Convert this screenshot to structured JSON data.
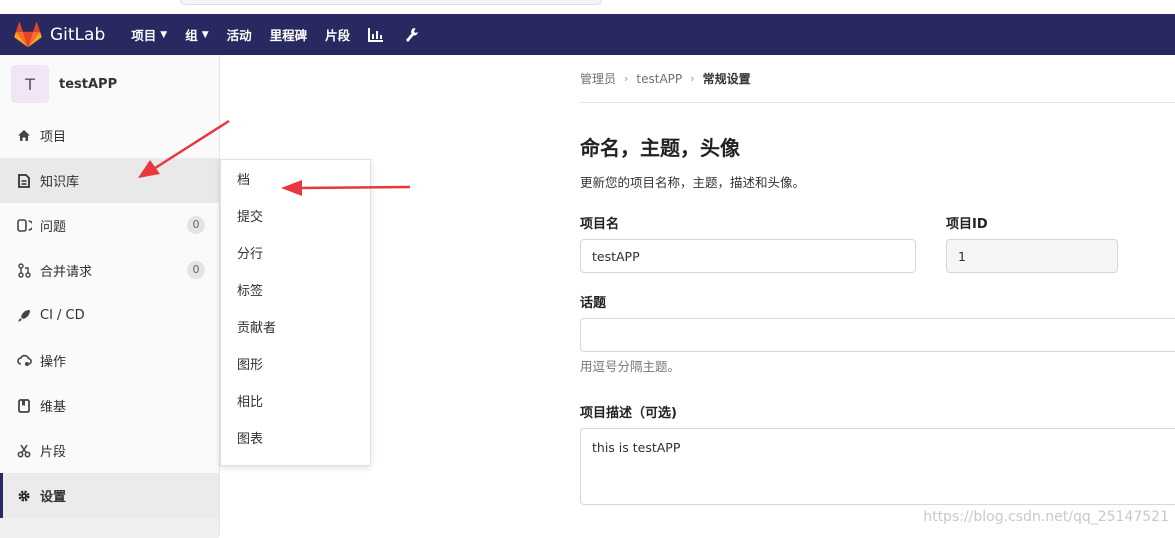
{
  "navbar": {
    "brand": "GitLab",
    "items": [
      {
        "label": "项目",
        "has_dropdown": true
      },
      {
        "label": "组",
        "has_dropdown": true
      },
      {
        "label": "活动",
        "has_dropdown": false
      },
      {
        "label": "里程碑",
        "has_dropdown": false
      },
      {
        "label": "片段",
        "has_dropdown": false
      }
    ],
    "icons": [
      "chart-icon",
      "wrench-icon"
    ],
    "colors": {
      "bg": "#292961",
      "logo": "#e24329"
    }
  },
  "sidebar": {
    "project_initial": "T",
    "project_name": "testAPP",
    "items": [
      {
        "label": "项目",
        "icon": "home-icon"
      },
      {
        "label": "知识库",
        "icon": "doc-icon"
      },
      {
        "label": "问题",
        "icon": "issues-icon",
        "count": "0"
      },
      {
        "label": "合并请求",
        "icon": "merge-icon",
        "count": "0"
      },
      {
        "label": "CI / CD",
        "icon": "rocket-icon"
      },
      {
        "label": "操作",
        "icon": "cloud-gear-icon"
      },
      {
        "label": "维基",
        "icon": "book-icon"
      },
      {
        "label": "片段",
        "icon": "scissors-icon"
      },
      {
        "label": "设置",
        "icon": "gear-icon"
      }
    ]
  },
  "flyout": {
    "items": [
      "档",
      "提交",
      "分行",
      "标签",
      "贡献者",
      "图形",
      "相比",
      "图表"
    ]
  },
  "breadcrumb": {
    "items": [
      "管理员",
      "testAPP"
    ],
    "current": "常规设置"
  },
  "main": {
    "title": "命名，主题，头像",
    "description": "更新您的项目名称，主题，描述和头像。",
    "project_name_label": "项目名",
    "project_name_value": "testAPP",
    "project_id_label": "项目ID",
    "project_id_value": "1",
    "topics_label": "话题",
    "topics_value": "",
    "topics_help": "用逗号分隔主题。",
    "description_label": "项目描述（可选)",
    "description_value": "this is testAPP"
  },
  "watermark": "https://blog.csdn.net/qq_25147521",
  "annotation_color": "#e8383d"
}
